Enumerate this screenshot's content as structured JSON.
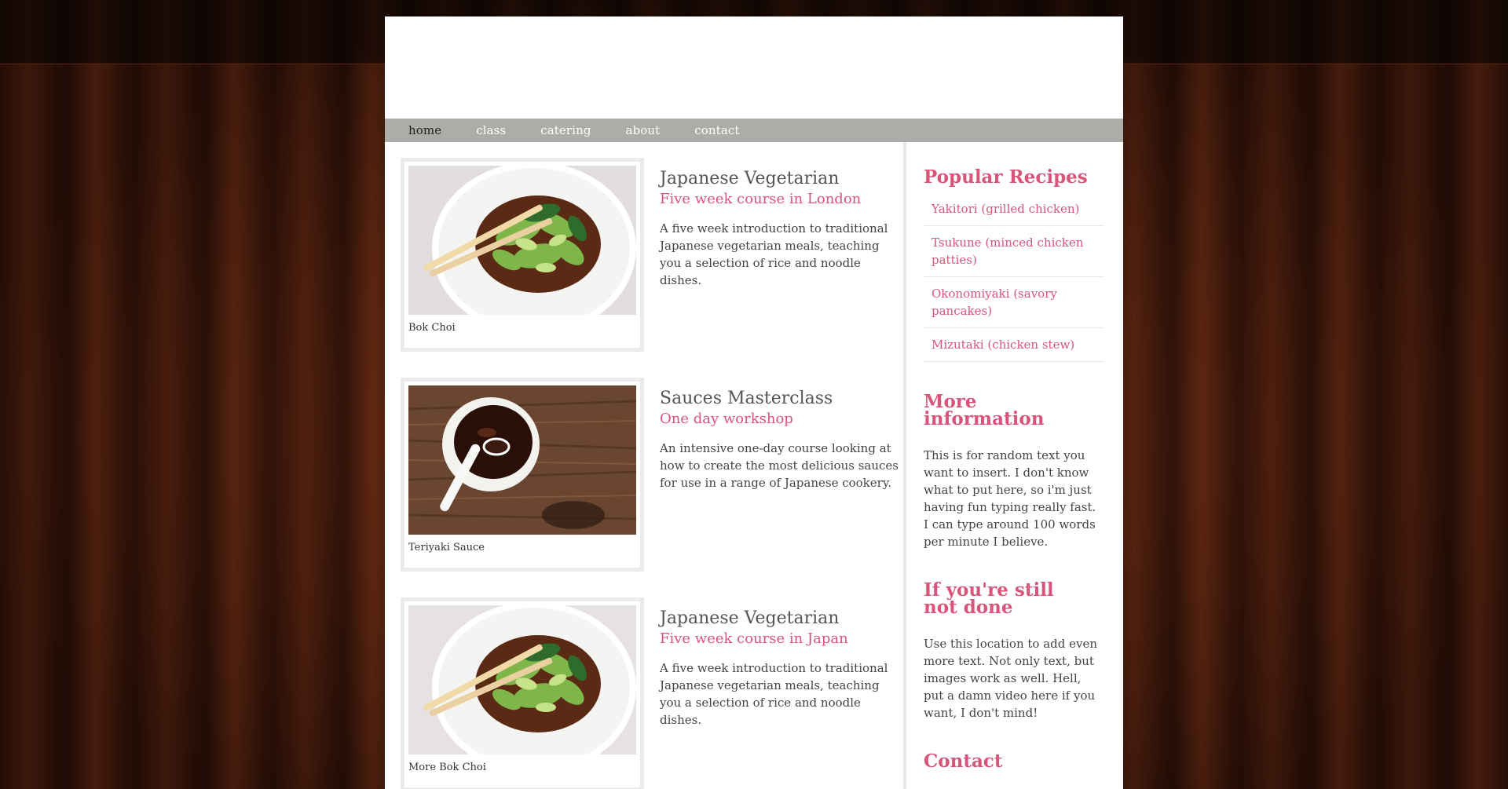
{
  "nav": {
    "items": [
      {
        "label": "home",
        "active": true
      },
      {
        "label": "class",
        "active": false
      },
      {
        "label": "catering",
        "active": false
      },
      {
        "label": "about",
        "active": false
      },
      {
        "label": "contact",
        "active": false
      }
    ]
  },
  "courses": [
    {
      "title": "Japanese Vegetarian",
      "subtitle": "Five week course in London",
      "description": "A five week introduction to traditional Japanese vegetarian meals, teaching you a selection of rice and noodle dishes.",
      "caption": "Bok Choi",
      "image": "bok-choi-bowl"
    },
    {
      "title": "Sauces Masterclass",
      "subtitle": "One day workshop",
      "description": "An intensive one-day course looking at how to create the most delicious sauces for use in a range of Japanese cookery.",
      "caption": "Teriyaki Sauce",
      "image": "teriyaki-sauce-cup"
    },
    {
      "title": "Japanese Vegetarian",
      "subtitle": "Five week course in Japan",
      "description": "A five week introduction to traditional Japanese vegetarian meals, teaching you a selection of rice and noodle dishes.",
      "caption": "More Bok Choi",
      "image": "bok-choi-bowl"
    }
  ],
  "sidebar": {
    "popular": {
      "heading": "Popular Recipes",
      "items": [
        "Yakitori (grilled chicken)",
        "Tsukune (minced chicken patties)",
        "Okonomiyaki (savory pancakes)",
        "Mizutaki (chicken stew)"
      ]
    },
    "more_info": {
      "heading": "More information",
      "text": "This is for random text you want to insert. I don't know what to put here, so i'm just having fun typing really fast. I can type around 100 words per minute I believe."
    },
    "still_not_done": {
      "heading": "If you're still not done",
      "text": "Use this location to add even more text. Not only text, but images work as well. Hell, put a damn video here if you want, I don't mind!"
    },
    "contact": {
      "heading": "Contact"
    }
  },
  "colors": {
    "accent": "#d9547a",
    "nav_bg": "#aeaca8",
    "frame": "#ebebeb"
  }
}
